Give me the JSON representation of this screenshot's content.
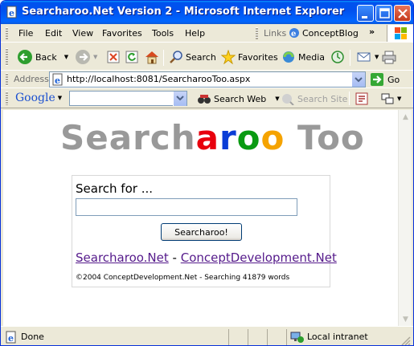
{
  "window": {
    "title": "Searcharoo.Net Version 2 - Microsoft Internet Explorer"
  },
  "menu": {
    "items": [
      "File",
      "Edit",
      "View",
      "Favorites",
      "Tools",
      "Help"
    ],
    "links_label": "Links",
    "link_concept": "ConceptBlog"
  },
  "toolbar": {
    "back": "Back",
    "search": "Search",
    "favorites": "Favorites",
    "media": "Media"
  },
  "address": {
    "label": "Address",
    "value": "http://localhost:8081/SearcharooToo.aspx",
    "go": "Go"
  },
  "google": {
    "logo": "Google",
    "search_web": "Search Web",
    "search_site": "Search Site"
  },
  "page": {
    "logo_parts": [
      {
        "text": "Searc",
        "color": "#999999"
      },
      {
        "text": "h",
        "color": "#999999"
      },
      {
        "text": "a",
        "color": "#e8000d"
      },
      {
        "text": "r",
        "color": "#0a3dd6"
      },
      {
        "text": "o",
        "color": "#0a9a12"
      },
      {
        "text": "o",
        "color": "#f5a300"
      },
      {
        "text": " Too",
        "color": "#999999"
      }
    ],
    "search_label": "Search for ...",
    "search_value": "",
    "search_button": "Searcharoo!",
    "link1": "Searcharoo.Net",
    "link_sep": " - ",
    "link2": "ConceptDevelopment.Net",
    "footer": "©2004 ConceptDevelopment.Net - Searching 41879 words"
  },
  "status": {
    "text": "Done",
    "zone": "Local intranet"
  },
  "colors": {
    "titlebar": "#0054e3",
    "chrome": "#ece9d8",
    "link_visited": "#551a8b"
  }
}
